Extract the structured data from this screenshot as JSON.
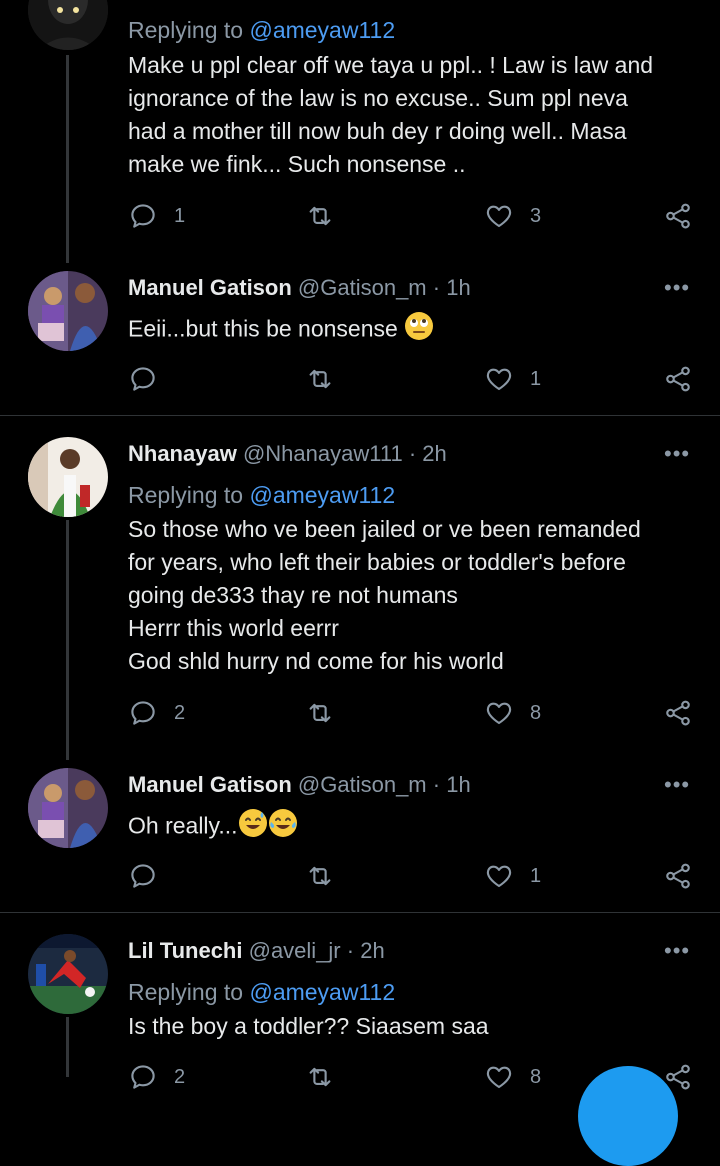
{
  "tweets": [
    {
      "replying_prefix": "Replying to",
      "replying_to": "@ameyaw112",
      "lines": [
        "Make u ppl clear off we taya u ppl.. ! Law is law and",
        "ignorance of the law is no excuse.. Sum ppl neva",
        "had a mother till now buh dey r doing well.. Masa",
        "make we fink... Such nonsense .."
      ],
      "replies": "1",
      "retweets": "",
      "likes": "3"
    },
    {
      "name": "Manuel Gatison",
      "handle": "@Gatison_m",
      "sep": "·",
      "time": "1h",
      "more": "•••",
      "text": "Eeii...but this be nonsense",
      "emoji": "face-with-rolling-eyes",
      "replies": "",
      "retweets": "",
      "likes": "1"
    },
    {
      "name": "Nhanayaw",
      "handle": "@Nhanayaw111",
      "sep": "·",
      "time": "2h",
      "more": "•••",
      "replying_prefix": "Replying to",
      "replying_to": "@ameyaw112",
      "lines": [
        "So those who  ve been jailed or ve been remanded",
        "for years, who left their babies or toddler's before",
        "going de333 thay re not humans",
        "Herrr this world eerrr",
        "God shld hurry nd come for his world"
      ],
      "replies": "2",
      "retweets": "",
      "likes": "8"
    },
    {
      "name": "Manuel Gatison",
      "handle": "@Gatison_m",
      "sep": "·",
      "time": "1h",
      "more": "•••",
      "text": "Oh really...",
      "emoji": "sweat-smile and tears-of-joy",
      "replies": "",
      "retweets": "",
      "likes": "1"
    },
    {
      "name": "Lil Tunechi",
      "handle": "@aveli_jr",
      "sep": "·",
      "time": "2h",
      "more": "•••",
      "replying_prefix": "Replying to",
      "replying_to": "@ameyaw112",
      "text": "Is the boy a toddler?? Siaasem saa",
      "replies": "2",
      "likes": "8"
    }
  ],
  "colors": {
    "background": "#000000",
    "text": "#e7e9ea",
    "muted": "#8b98a5",
    "mention": "#4d9cf2",
    "divider": "#2f3336",
    "thread_line": "#333639"
  }
}
